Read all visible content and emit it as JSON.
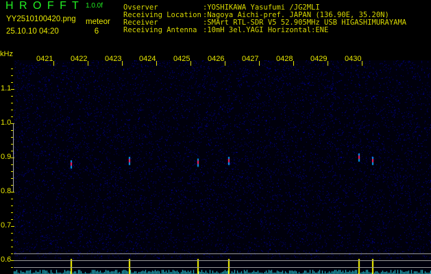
{
  "header": {
    "app_title": "H R O F F T",
    "version": "1.0.0f",
    "filename": "YY2510100420.png",
    "datetime": "25.10.10 04:20",
    "meteor_label": "meteor",
    "meteor_count": "6"
  },
  "info": [
    {
      "label": "Ovserver",
      "value": ":YOSHIKAWA Yasufumi /JG2MLI"
    },
    {
      "label": "Receiving Location",
      "value": ":Nagoya Aichi-pref. JAPAN (136.90E, 35.20N)"
    },
    {
      "label": "Receiver",
      "value": ":SMArt RTL-SDR V5 52.905MHz USB HIGASHIMURAYAMA"
    },
    {
      "label": "Receiving Antenna",
      "value": ":10mH 3el.YAGI Horizontal:ENE"
    }
  ],
  "axis": {
    "unit": "kHz",
    "y_ticks": [
      "1.1",
      "1.0",
      "0.9",
      "0.8",
      "0.7",
      "0.6"
    ],
    "time_ticks": [
      "0421",
      "0422",
      "0423",
      "0424",
      "0425",
      "0426",
      "0427",
      "0428",
      "0429",
      "0430"
    ]
  },
  "colors": {
    "background": "#000000",
    "noise": "#1010a0",
    "text": "#e8e800",
    "title": "#22ee22"
  },
  "meteors": [
    {
      "time": "04:21.4",
      "khz": 0.88
    },
    {
      "time": "04:23.1",
      "khz": 0.89
    },
    {
      "time": "04:25.1",
      "khz": 0.885
    },
    {
      "time": "04:26.0",
      "khz": 0.89
    },
    {
      "time": "04:29.8",
      "khz": 0.9
    },
    {
      "time": "04:30.2",
      "khz": 0.89
    }
  ]
}
